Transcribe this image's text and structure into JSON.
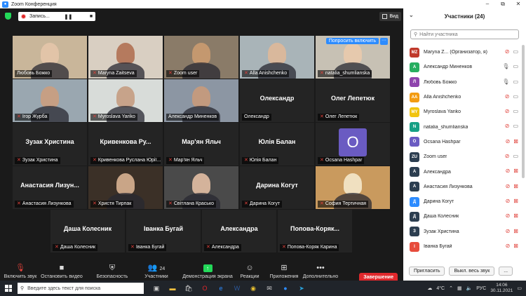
{
  "window": {
    "title": "Zoom Конференция",
    "minimize": "–",
    "maximize": "⧉",
    "close": "✕"
  },
  "topbar": {
    "recording_label": "Запись...",
    "pause": "❚❚",
    "stop": "■",
    "view_label": "Вид"
  },
  "tiles": [
    {
      "label": "Любовь Божко",
      "mic_off": false,
      "video": true,
      "bg": "#c9b69a",
      "skin": "#e2c4a8"
    },
    {
      "label": "Maryna Zaitseva",
      "mic_off": true,
      "video": true,
      "bg": "#d9cfc2",
      "skin": "#b57a5e"
    },
    {
      "label": "Zoom user",
      "mic_off": true,
      "video": true,
      "bg": "#8a7b68",
      "skin": "#c4986f"
    },
    {
      "label": "Alla Anishchenko",
      "mic_off": true,
      "video": true,
      "bg": "#a9b4b8",
      "skin": "#d9b89c"
    },
    {
      "label": "natalia_shumlianska",
      "mic_off": true,
      "video": true,
      "bg": "#c7c1b4",
      "skin": "#e6c9ad",
      "let_in": "Попросить включить",
      "more": "···"
    },
    {
      "label": "Ігор Журба",
      "mic_off": true,
      "video": true,
      "bg": "#9aa7b0",
      "skin": "#c69f84"
    },
    {
      "label": "Myroslava Yariko",
      "mic_off": true,
      "video": true,
      "bg": "#d8dcd9",
      "skin": "#c7a38a"
    },
    {
      "label": "Александр Миненков",
      "mic_off": false,
      "video": true,
      "bg": "#8c96a3",
      "skin": "#c29a7f",
      "active": true
    },
    {
      "label": "Олександр",
      "mic_off": false,
      "video": false,
      "center": "Олександр"
    },
    {
      "label": "Олег Лепетюк",
      "mic_off": true,
      "video": false,
      "center": "Олег Лепетюк"
    },
    {
      "label": "Зузак Христина",
      "mic_off": true,
      "video": false,
      "center": "Зузак Христина"
    },
    {
      "label": "Кривенкова Руслана Юрії...",
      "mic_off": true,
      "video": false,
      "center": "Кривенкова  Ру..."
    },
    {
      "label": "Мар'ян Яльч",
      "mic_off": true,
      "video": false,
      "center": "Мар'ян Яльч"
    },
    {
      "label": "Юлія Балан",
      "mic_off": true,
      "video": false,
      "center": "Юлія Балан"
    },
    {
      "label": "Ocsana Hashpar",
      "mic_off": true,
      "video": false,
      "avatar": "O"
    },
    {
      "label": "Анастасия Лизункова",
      "mic_off": true,
      "video": false,
      "center": "Анастасия  Лизун..."
    },
    {
      "label": "Христя Тирпак",
      "mic_off": true,
      "video": true,
      "bg": "#3b3027",
      "skin": "#c9a587"
    },
    {
      "label": "Світлана Красько",
      "mic_off": true,
      "video": true,
      "bg": "#4a4a4a",
      "skin": "#d4b39b"
    },
    {
      "label": "Дарина Когут",
      "mic_off": true,
      "video": false,
      "center": "Дарина Когут"
    },
    {
      "label": "София Тертичная",
      "mic_off": true,
      "video": true,
      "bg": "#c99a5e",
      "skin": "#f0e0c0"
    },
    {
      "label": "Даша Колесник",
      "mic_off": true,
      "video": false,
      "center": "Даша Колесник"
    },
    {
      "label": "Іванка Бугай",
      "mic_off": true,
      "video": false,
      "center": "Іванка Бугай"
    },
    {
      "label": "Александра",
      "mic_off": true,
      "video": false,
      "center": "Александра"
    },
    {
      "label": "Попова-Коряк Карина",
      "mic_off": true,
      "video": false,
      "center": "Попова-Коряк..."
    }
  ],
  "toolbar": {
    "unmute": "Включить звук",
    "stop_video": "Остановить видео",
    "security": "Безопасность",
    "participants": "Участники",
    "participants_count": "24",
    "share": "Демонстрация экрана",
    "reactions": "Реакции",
    "apps": "Приложения",
    "more": "Дополнительно",
    "end": "Завершение"
  },
  "panel": {
    "title": "Участники (24)",
    "search_placeholder": "Найти участника",
    "invite": "Пригласить",
    "mute_all": "Выкл. весь звук",
    "more": "...",
    "participants": [
      {
        "initials": "MZ",
        "name": "Maryna Z... (Организатор, я)",
        "color": "#c0392b",
        "mic": "off",
        "cam": "on"
      },
      {
        "initials": "А",
        "name": "Александр Миненков",
        "color": "#27ae60",
        "mic": "on",
        "cam": "on"
      },
      {
        "initials": "Л",
        "name": "Любовь Божко",
        "color": "#8e44ad",
        "mic": "on",
        "cam": "on"
      },
      {
        "initials": "AA",
        "name": "Alla Anishchenko",
        "color": "#f39c12",
        "mic": "off",
        "cam": "on"
      },
      {
        "initials": "MY",
        "name": "Myroslava Yariko",
        "color": "#f1c40f",
        "mic": "off",
        "cam": "on"
      },
      {
        "initials": "N",
        "name": "natalia_shumlianska",
        "color": "#16a085",
        "mic": "off",
        "cam": "on"
      },
      {
        "initials": "O",
        "name": "Ocsana Hashpar",
        "color": "#6a5bc2",
        "mic": "off",
        "cam": "off"
      },
      {
        "initials": "ZU",
        "name": "Zoom user",
        "color": "#2c3e50",
        "mic": "off",
        "cam": "on"
      },
      {
        "initials": "А",
        "name": "Александра",
        "color": "#2c3e50",
        "mic": "off",
        "cam": "off"
      },
      {
        "initials": "А",
        "name": "Анастасия Лизункова",
        "color": "#2c3e50",
        "mic": "off",
        "cam": "off"
      },
      {
        "initials": "Д",
        "name": "Дарина Когут",
        "color": "#2d8cff",
        "mic": "off",
        "cam": "off"
      },
      {
        "initials": "Д",
        "name": "Даша Колесник",
        "color": "#2c3e50",
        "mic": "off",
        "cam": "off"
      },
      {
        "initials": "З",
        "name": "Зузак Христина",
        "color": "#2c3e50",
        "mic": "off",
        "cam": "off"
      },
      {
        "initials": "І",
        "name": "Іванка Бугай",
        "color": "#e74c3c",
        "mic": "off",
        "cam": "off"
      }
    ]
  },
  "taskbar": {
    "search_placeholder": "Введите здесь текст для поиска",
    "weather": "4°C",
    "lang": "РУС",
    "time": "14:06",
    "date": "30.11.2021"
  }
}
